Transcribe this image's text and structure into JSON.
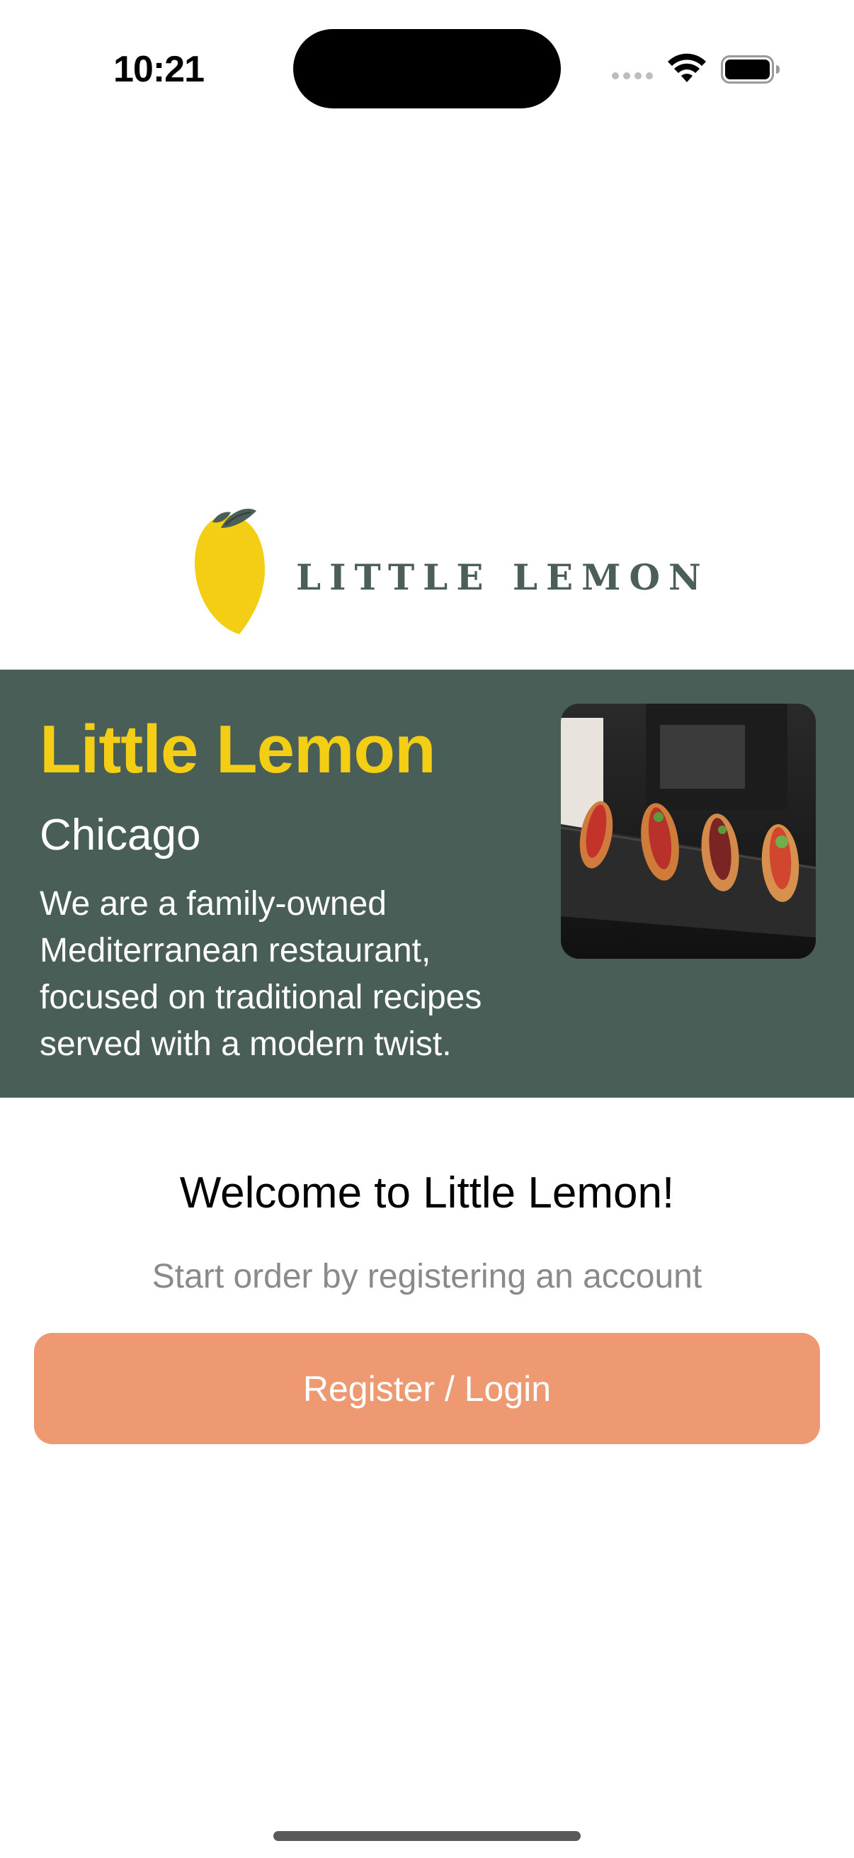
{
  "status_bar": {
    "time": "10:21",
    "icons": [
      "cellular-signal-icon",
      "wifi-icon",
      "battery-icon"
    ]
  },
  "logo": {
    "text": "LITTLE LEMON",
    "icon": "lemon-icon"
  },
  "hero": {
    "title": "Little Lemon",
    "city": "Chicago",
    "description": "We are a family-owned Mediterranean restaurant, focused on traditional recipes served with a modern twist.",
    "image": "food-platter-image"
  },
  "welcome": {
    "title": "Welcome to Little Lemon!",
    "subtitle": "Start order by registering an account",
    "button_label": "Register / Login"
  },
  "colors": {
    "hero_background": "#495e57",
    "title_yellow": "#f4ce14",
    "button_orange": "#ee9972",
    "subtitle_gray": "#8a8a8e"
  }
}
